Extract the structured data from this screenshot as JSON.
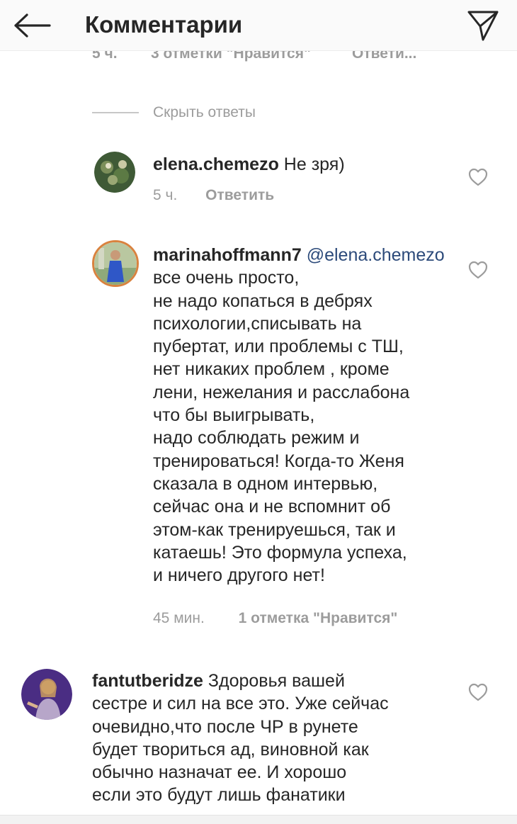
{
  "header": {
    "title": "Комментарии",
    "back_icon": "arrow-left-icon",
    "send_icon": "paper-plane-icon"
  },
  "previous_comment": {
    "time": "5 ч.",
    "likes": "3 отметки \"Нравится\"",
    "reply": "Ответи..."
  },
  "hide_replies": "Скрыть ответы",
  "comments": [
    {
      "username": "elena.chemezo",
      "text": " Не зря)",
      "time": "5 ч.",
      "reply": "Ответить",
      "likes": ""
    },
    {
      "username": "marinahoffmann7",
      "mention": "@elena.chemezo",
      "lines": [
        " все очень просто,",
        "не надо копаться в дебрях",
        "психологии,списывать на",
        "пубертат, или проблемы с ТШ,",
        "нет никаких проблем , кроме",
        "лени, нежелания и расслабона",
        "что бы выигрывать,",
        "надо соблюдать режим и",
        "тренироваться! Когда-то Женя",
        "сказала в одном интервью,",
        "сейчас она и не вспомнит об",
        "этом-как тренируешься, так и",
        "катаешь! Это формула успеха,",
        "и ничего другого нет!"
      ],
      "time": "45 мин.",
      "likes": "1 отметка \"Нравится\""
    },
    {
      "username": "fantutberidze",
      "lines": [
        " Здоровья вашей",
        "сестре и сил на все это. Уже сейчас",
        "очевидно,что после ЧР в рунете",
        "будет твориться ад, виновной как",
        "обычно назначат ее. И хорошо",
        "если это будут лишь фанатики"
      ]
    }
  ],
  "colors": {
    "text": "#262626",
    "secondary": "#9c9c9c",
    "mention": "#2c4a7a",
    "header_bg": "#fafafa"
  }
}
